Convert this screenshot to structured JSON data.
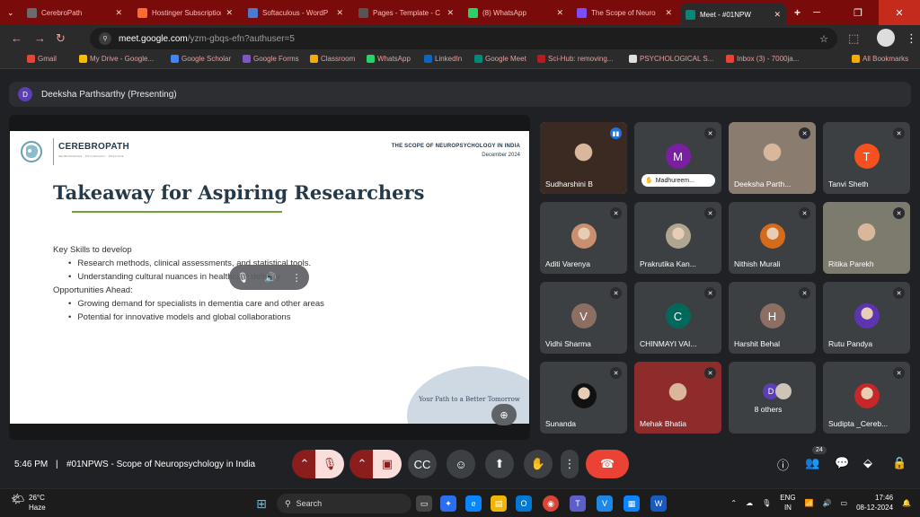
{
  "tabs": [
    {
      "label": "CerebroPath",
      "color": "#6b6b6b"
    },
    {
      "label": "Hostinger Subscription",
      "color": "#ff6a2b"
    },
    {
      "label": "Softaculous - WordP",
      "color": "#4a7bd0"
    },
    {
      "label": "Pages - Template - C",
      "color": "#555555"
    },
    {
      "label": "(8) WhatsApp",
      "color": "#25d366"
    },
    {
      "label": "The Scope of Neuro",
      "color": "#7c4dff"
    },
    {
      "label": "Meet - #01NPW",
      "color": "#00897b"
    }
  ],
  "new_tab": "+",
  "address": {
    "host": "meet.google.com",
    "path": "/yzm-gbqs-efn?authuser=5"
  },
  "bookmarks": [
    {
      "label": "Gmail",
      "color": "#ea4335"
    },
    {
      "label": "My Drive - Google...",
      "color": "#fbbc04"
    },
    {
      "label": "Google Scholar",
      "color": "#4285f4"
    },
    {
      "label": "Google Forms",
      "color": "#7e57c2"
    },
    {
      "label": "Classroom",
      "color": "#f9ab00"
    },
    {
      "label": "WhatsApp",
      "color": "#25d366"
    },
    {
      "label": "LinkedIn",
      "color": "#0a66c2"
    },
    {
      "label": "Google Meet",
      "color": "#00897b"
    },
    {
      "label": "Sci-Hub: removing...",
      "color": "#b71c1c"
    },
    {
      "label": "PSYCHOLOGICAL S...",
      "color": "#e0e0e0"
    },
    {
      "label": "Inbox (3) - 7000ja...",
      "color": "#ea4335"
    },
    {
      "label": "All Bookmarks",
      "color": "#f9ab00"
    }
  ],
  "presenter": {
    "initial": "D",
    "label": "Deeksha Parthsarthy (Presenting)"
  },
  "slide": {
    "brand": "CEREBROPATH",
    "brand_sub": "NEUROSCIENCE · PSYCHOLOGY · PRACTICE",
    "header": "THE SCOPE OF NEUROPSYCHOLOGY IN INDIA",
    "date": "December 2024",
    "title": "Takeaway for Aspiring Researchers",
    "section1": "Key Skills to develop",
    "bullet1": "Research methods, clinical assessments, and statistical tools.",
    "bullet2": "Understanding cultural nuances in healthcare delivery.",
    "section2": "Opportunities Ahead:",
    "bullet3": "Growing demand for specialists in dementia care and other areas",
    "bullet4": "Potential for innovative models and global collaborations",
    "tagline": "Your Path to a Better Tomorrow"
  },
  "participants": [
    {
      "name": "Sudharshini B",
      "type": "cam",
      "speaking": true,
      "bg": "#3a2a22"
    },
    {
      "name": "Madhureem...",
      "type": "avatar",
      "initial": "M",
      "color": "#7b1fa2",
      "chip": true
    },
    {
      "name": "Deeksha Parth...",
      "type": "cam",
      "bg": "#8a7d70"
    },
    {
      "name": "Tanvi Sheth",
      "type": "avatar",
      "initial": "T",
      "color": "#f4511e"
    },
    {
      "name": "Aditi Varenya",
      "type": "photo",
      "color": "#c98f6e"
    },
    {
      "name": "Prakrutika Kan...",
      "type": "photo",
      "color": "#b0a590"
    },
    {
      "name": "Nithish Murali",
      "type": "photo",
      "color": "#d46b1a"
    },
    {
      "name": "Ritika Parekh",
      "type": "cam",
      "bg": "#7d7a6e"
    },
    {
      "name": "Vidhi Sharma",
      "type": "avatar",
      "initial": "V",
      "color": "#8d6e63"
    },
    {
      "name": "CHINMAYI VAI...",
      "type": "avatar",
      "initial": "C",
      "color": "#00695c"
    },
    {
      "name": "Harshit Behal",
      "type": "avatar",
      "initial": "H",
      "color": "#8d6e63"
    },
    {
      "name": "Rutu Pandya",
      "type": "photo",
      "color": "#5e35b1"
    },
    {
      "name": "Sunanda",
      "type": "photo",
      "color": "#111111"
    },
    {
      "name": "Mehak Bhatia",
      "type": "cam",
      "bg": "#8e2b2b"
    },
    {
      "name": "8 others",
      "type": "others",
      "initial": "D"
    },
    {
      "name": "Sudipta _Cereb...",
      "type": "photo",
      "color": "#c62828"
    }
  ],
  "meeting": {
    "time": "5:46 PM",
    "separator": "|",
    "code": "#01NPWS - Scope of Neuropsychology in India",
    "people_count": "24"
  },
  "taskbar": {
    "temp": "26°C",
    "weather": "Haze",
    "search": "Search",
    "lang": "ENG",
    "region": "IN",
    "clock": "17:46",
    "date": "08-12-2024"
  }
}
